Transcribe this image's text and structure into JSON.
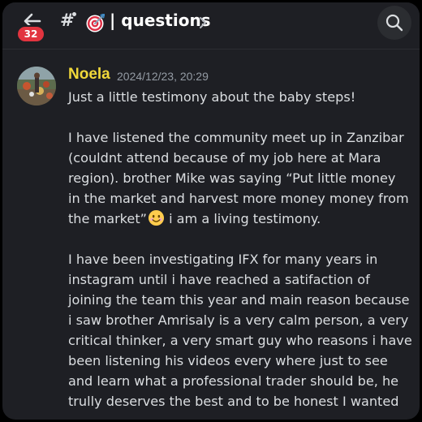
{
  "header": {
    "back_icon": "arrow-left-icon",
    "unread_count": "32",
    "channel_prefix_icon": "hash-icon",
    "channel_emoji": "🎯",
    "channel_name": "| questions",
    "chevron_icon": "chevron-right-icon",
    "search_icon": "search-icon"
  },
  "message": {
    "author": "Noela",
    "author_color": "#f0d83a",
    "timestamp": "2024/12/23, 20:29",
    "lines": {
      "l1": "Just a little testimony about the baby steps!",
      "l2": "I have listened the community meet up in Zanzibar",
      "l3": "(couldnt attend because of my job here at Mara",
      "l4": "region). brother Mike was saying “Put little money",
      "l5": "in the market and harvest more money money from",
      "l6": "the market”",
      "l6_emoji": "😊",
      "l6_tail": " i am a living testimony.",
      "l7": "I have been investigating IFX for many years in",
      "l8": "instagram until i have reached a satifaction of",
      "l9": "joining the team this year and main reason because",
      "l10": "i saw brother Amrisaly is a very calm person, a very",
      "l11": "critical thinker, a very smart guy who reasons i have",
      "l12": "been listening his videos every where just to see",
      "l13": "and learn what a professional trader should be, he",
      "l14": "trully deserves the best and to be honest I wanted"
    }
  },
  "colors": {
    "background": "#1e1f24",
    "text": "#dbdee1",
    "muted": "#949ba4",
    "badge": "#e2343f"
  }
}
